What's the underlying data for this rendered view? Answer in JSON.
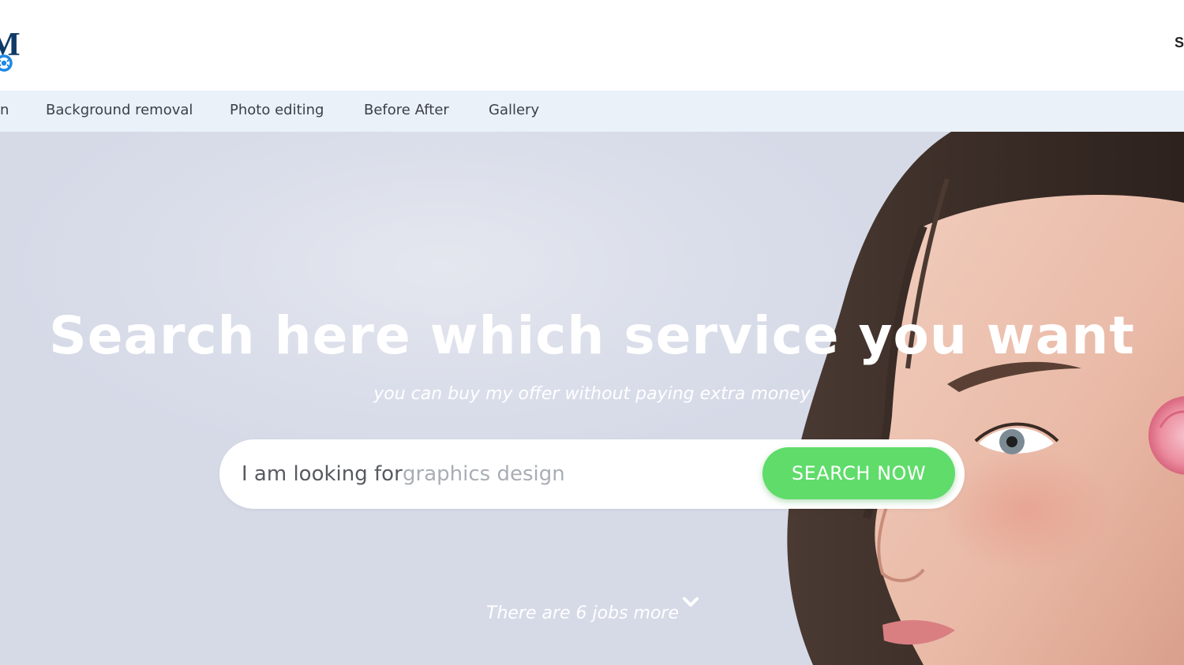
{
  "header": {
    "logo": {
      "letter": "M",
      "icon": "camera-ring-icon",
      "accent": "#1e88e5"
    },
    "right_partial_text": "S"
  },
  "nav": {
    "items": [
      {
        "label": "n"
      },
      {
        "label": "Background removal"
      },
      {
        "label": "Photo editing"
      },
      {
        "label": "Before After"
      },
      {
        "label": "Gallery"
      }
    ]
  },
  "hero": {
    "title": "Search here which service you want",
    "subtitle": "you can buy my offer without paying extra money",
    "search": {
      "prefix": "I am looking for",
      "placeholder": "graphics design",
      "value": "",
      "button_label": "SEARCH NOW"
    },
    "jobs_more": "There are 6 jobs more",
    "jobs_more_icon": "chevron-down-icon"
  },
  "colors": {
    "nav_background": "#eaf1f9",
    "hero_background": "#d9dde9",
    "button": "#5fdc6a",
    "logo_dark": "#0f3a66",
    "logo_accent": "#1e88e5"
  }
}
